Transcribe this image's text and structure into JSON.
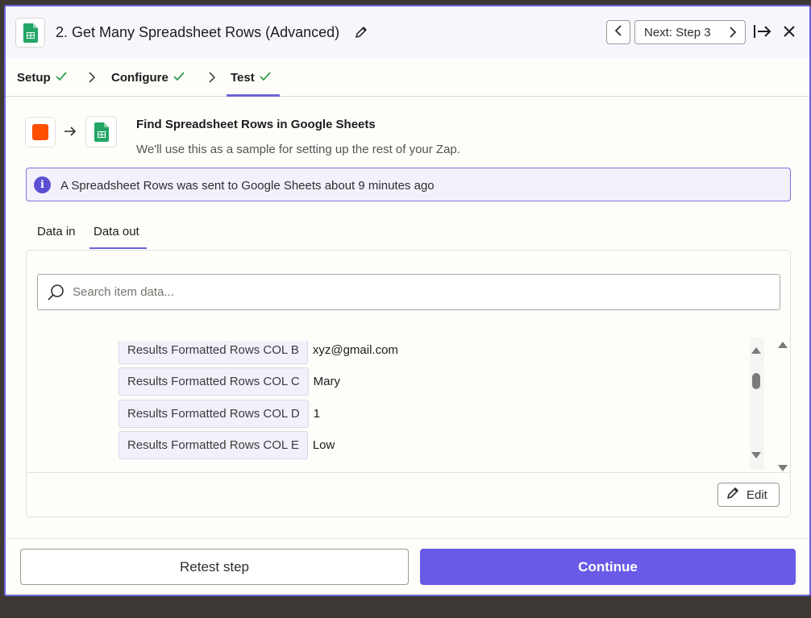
{
  "header": {
    "title": "2. Get Many Spreadsheet Rows (Advanced)",
    "next_label": "Next: Step 3"
  },
  "tabs": [
    {
      "label": "Setup",
      "status": "complete"
    },
    {
      "label": "Configure",
      "status": "complete"
    },
    {
      "label": "Test",
      "status": "complete",
      "active": true
    }
  ],
  "action": {
    "title": "Find Spreadsheet Rows in Google Sheets",
    "subtitle": "We'll use this as a sample for setting up the rest of your Zap."
  },
  "info_banner": {
    "text": "A Spreadsheet Rows was sent to Google Sheets about 9 minutes ago"
  },
  "data_tabs": [
    {
      "label": "Data in"
    },
    {
      "label": "Data out",
      "active": true
    }
  ],
  "search": {
    "placeholder": "Search item data..."
  },
  "rows": [
    {
      "key": "Results Formatted Rows COL B",
      "value": "xyz@gmail.com"
    },
    {
      "key": "Results Formatted Rows COL C",
      "value": "Mary"
    },
    {
      "key": "Results Formatted Rows COL D",
      "value": "1"
    },
    {
      "key": "Results Formatted Rows COL E",
      "value": "Low"
    }
  ],
  "edit_label": "Edit",
  "footer": {
    "retest_label": "Retest step",
    "continue_label": "Continue"
  },
  "colors": {
    "accent": "#695be8",
    "check": "#2e9e4f",
    "zapier_orange": "#ff4f00",
    "sheets_green": "#23a566"
  },
  "icons": [
    "google-sheets-icon",
    "pencil-icon",
    "chevron-left-icon",
    "chevron-right-icon",
    "collapse-panel-icon",
    "close-icon",
    "check-icon",
    "arrow-right-icon",
    "info-icon",
    "search-icon",
    "triangle-up-icon",
    "triangle-down-icon"
  ]
}
